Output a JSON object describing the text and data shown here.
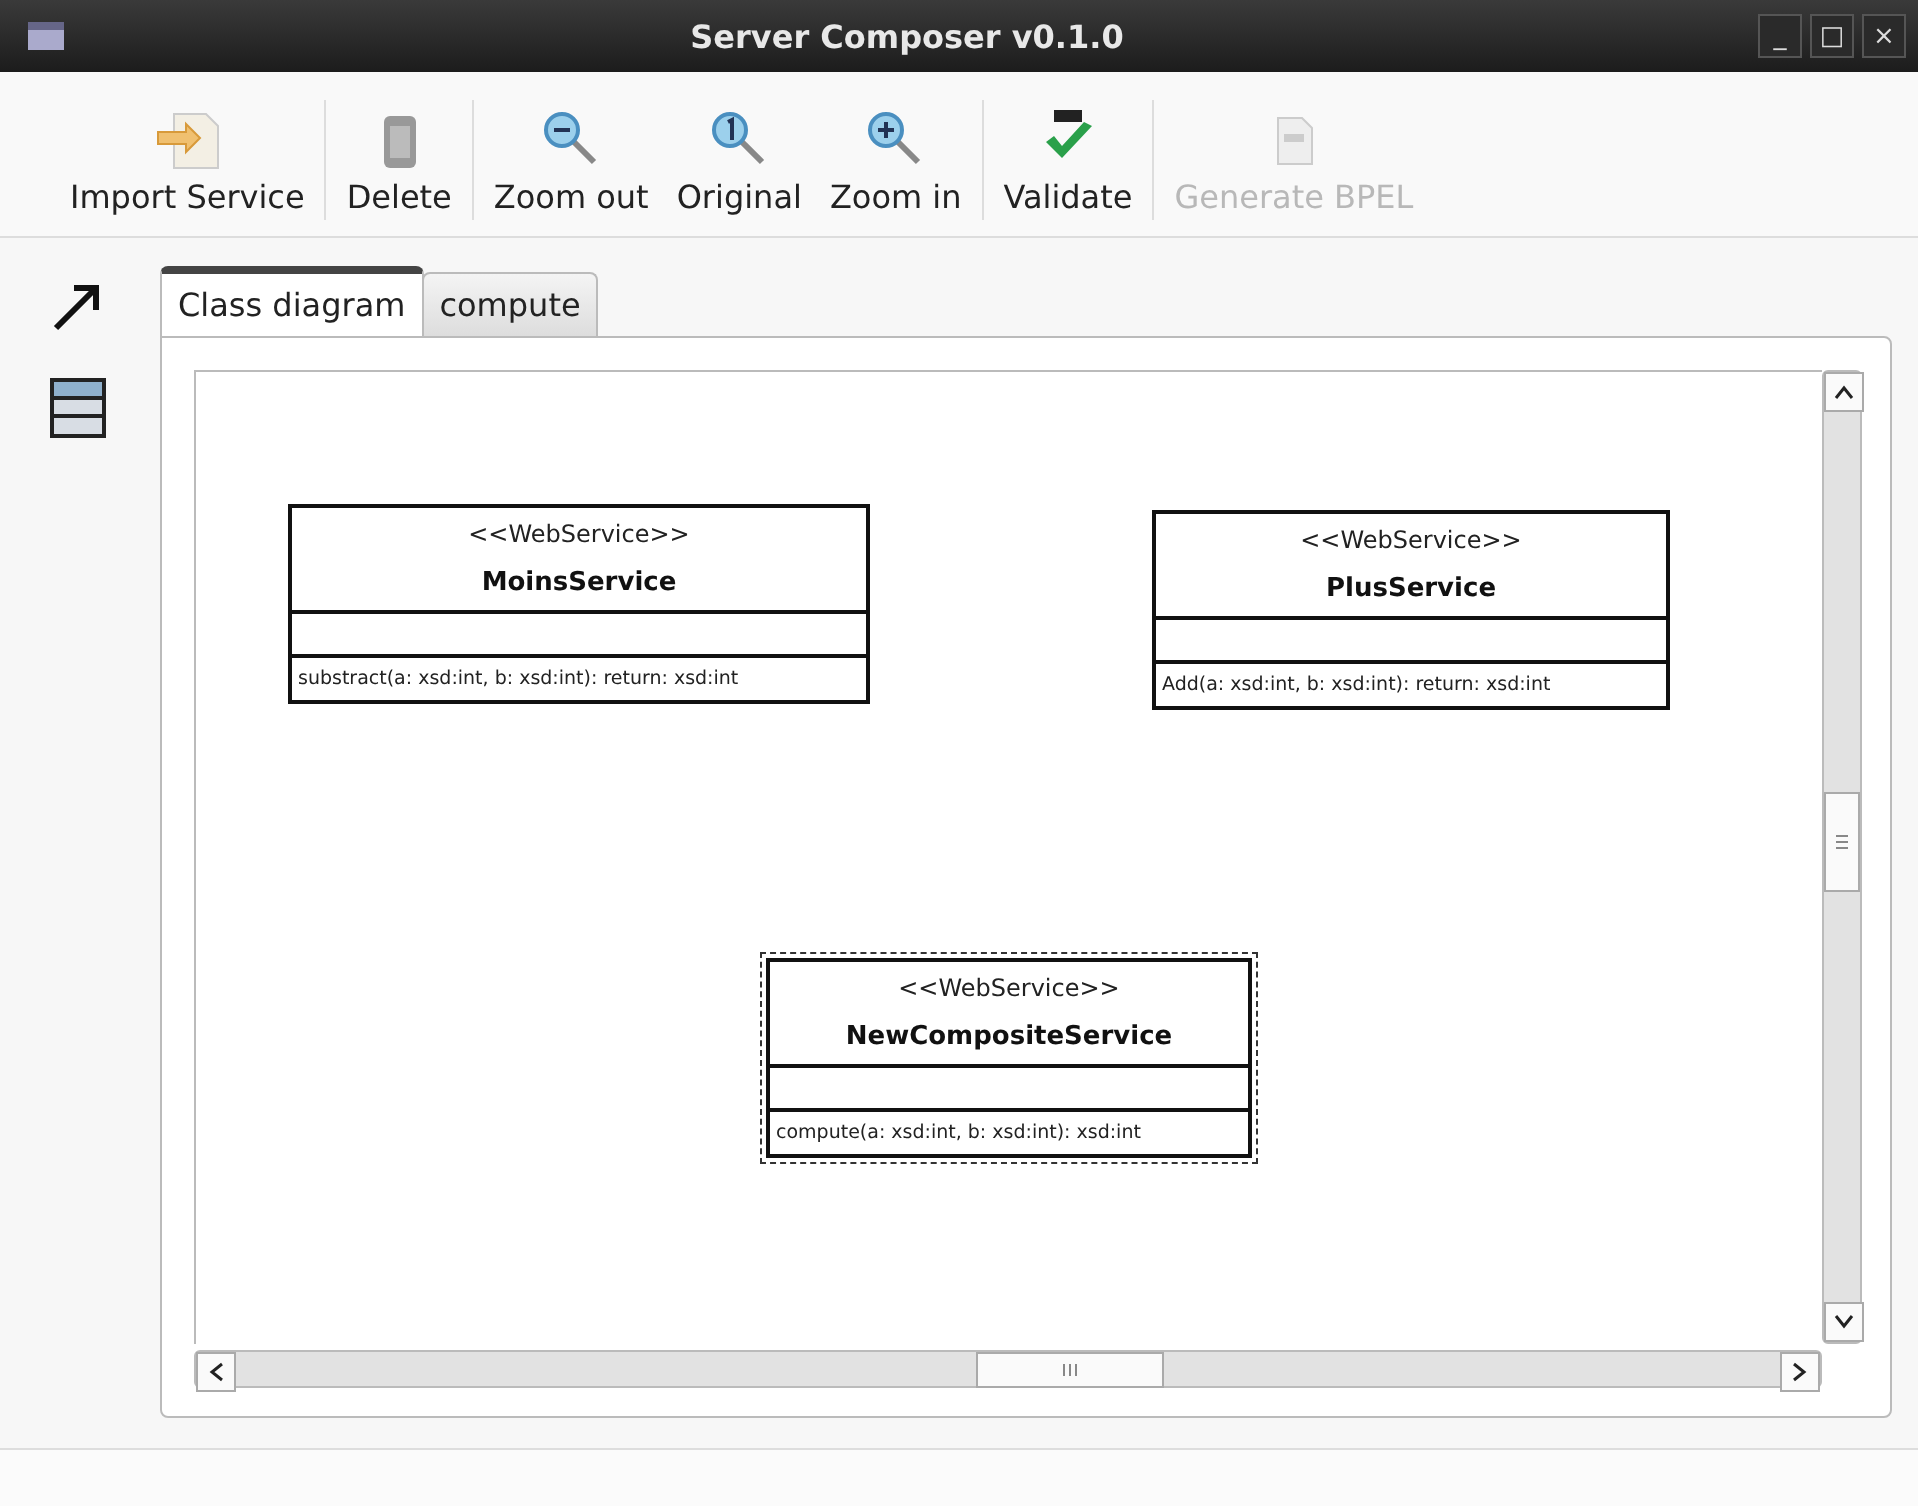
{
  "window": {
    "title": "Server Composer v0.1.0",
    "controls": [
      "_",
      "□",
      "×"
    ]
  },
  "toolbar": [
    {
      "kind": "import",
      "label": "Import Service",
      "disabled": false
    },
    {
      "kind": "delete",
      "label": "Delete",
      "disabled": false,
      "separator_before": true
    },
    {
      "kind": "zoom_out",
      "label": "Zoom out",
      "disabled": false,
      "separator_before": true
    },
    {
      "kind": "zoom_original",
      "label": "Original",
      "disabled": false
    },
    {
      "kind": "zoom_in",
      "label": "Zoom in",
      "disabled": false
    },
    {
      "kind": "validate",
      "label": "Validate",
      "disabled": false,
      "separator_before": true
    },
    {
      "kind": "generate",
      "label": "Generate BPEL",
      "disabled": true,
      "separator_before": true
    }
  ],
  "tabs": [
    {
      "label": "Class diagram",
      "selected": true
    },
    {
      "label": "compute",
      "selected": false
    }
  ],
  "diagram": {
    "classes": [
      {
        "stereotype": "<<WebService>>",
        "name": "MoinsService",
        "operations": [
          "substract(a: xsd:int, b: xsd:int): return: xsd:int"
        ],
        "selected": false
      },
      {
        "stereotype": "<<WebService>>",
        "name": "PlusService",
        "operations": [
          "Add(a: xsd:int, b: xsd:int): return: xsd:int"
        ],
        "selected": false
      },
      {
        "stereotype": "<<WebService>>",
        "name": "NewCompositeService",
        "operations": [
          "compute(a: xsd:int, b: xsd:int): xsd:int"
        ],
        "selected": true
      }
    ]
  }
}
